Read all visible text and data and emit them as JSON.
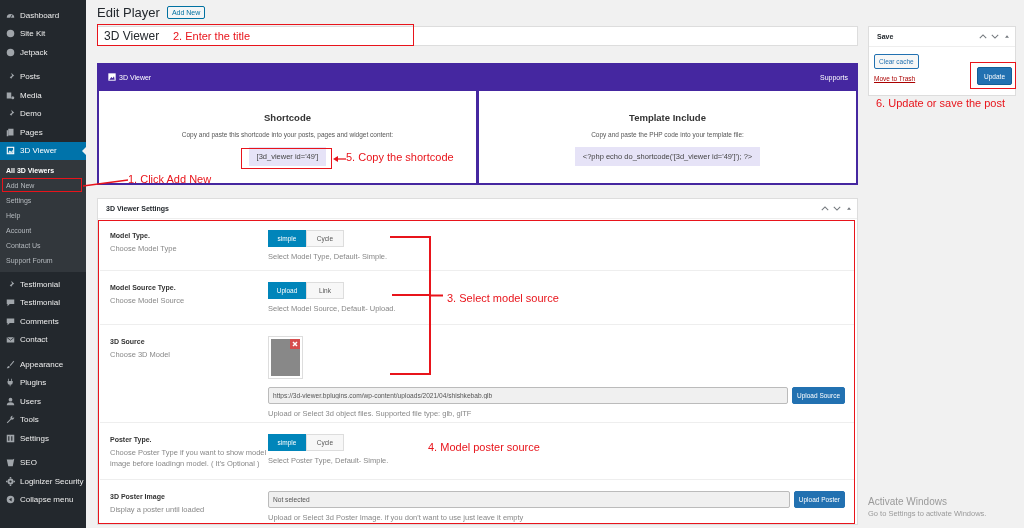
{
  "sidebar": {
    "groups": [
      [
        {
          "label": "Dashboard",
          "selected": false
        },
        {
          "label": "Site Kit",
          "selected": false
        },
        {
          "label": "Jetpack",
          "selected": false
        }
      ],
      [
        {
          "label": "Posts",
          "selected": false
        },
        {
          "label": "Media",
          "selected": false
        },
        {
          "label": "Demo",
          "selected": false
        },
        {
          "label": "Pages",
          "selected": false
        },
        {
          "label": "3D Viewer",
          "selected": true,
          "children": [
            {
              "label": "All 3D Viewers",
              "selected": true
            },
            {
              "label": "Add New",
              "selected": false
            },
            {
              "label": "Settings",
              "selected": false
            },
            {
              "label": "Help",
              "selected": false
            },
            {
              "label": "Account",
              "selected": false
            },
            {
              "label": "Contact Us",
              "selected": false
            },
            {
              "label": "Support Forum",
              "selected": false
            }
          ]
        }
      ],
      [
        {
          "label": "Testimonial",
          "selected": false
        },
        {
          "label": "Testimonial",
          "selected": false
        },
        {
          "label": "Comments",
          "selected": false
        },
        {
          "label": "Contact",
          "selected": false
        }
      ],
      [
        {
          "label": "Appearance",
          "selected": false
        },
        {
          "label": "Plugins",
          "selected": false
        },
        {
          "label": "Users",
          "selected": false
        },
        {
          "label": "Tools",
          "selected": false
        },
        {
          "label": "Settings",
          "selected": false
        }
      ],
      [
        {
          "label": "SEO",
          "selected": false
        },
        {
          "label": "Loginizer Security",
          "selected": false
        },
        {
          "label": "Collapse menu",
          "selected": false
        }
      ]
    ]
  },
  "header": {
    "title": "Edit Player",
    "button": "Add New"
  },
  "title_field": {
    "value": "3D Viewer"
  },
  "plugin_panel": {
    "name": "3D Viewer",
    "link": "Supports",
    "cards": [
      {
        "title": "Shortcode",
        "description": "Copy and paste this shortcode into your posts, pages and widget content:",
        "code": "[3d_viewer id='49']"
      },
      {
        "title": "Template Include",
        "description": "Copy and paste the PHP code into your template file:",
        "code": "<?php echo do_shortcode('[3d_viewer id='49']'); ?>"
      }
    ]
  },
  "settings": {
    "title": "3D Viewer Settings",
    "rows": [
      {
        "kind": "toggle",
        "label": "Model Type.",
        "description": "Choose Model Type",
        "options": [
          {
            "label": "simple",
            "selected": true
          },
          {
            "label": "Cycle",
            "selected": false
          }
        ],
        "help": "Select Model Type, Default- Simple."
      },
      {
        "kind": "toggle",
        "label": "Model Source Type.",
        "description": "Choose Model Source",
        "options": [
          {
            "label": "Upload",
            "selected": true
          },
          {
            "label": "Link",
            "selected": false
          }
        ],
        "help": "Select Model Source, Default- Upload."
      },
      {
        "kind": "media",
        "label": "3D Source",
        "description": "Choose 3D Model",
        "value": "https://3d-viewer.bplugins.com/wp-content/uploads/2021/04/shishkebab.glb",
        "button": "Upload Source",
        "help": "Upload or Select 3d object files. Supported file type: glb, glTF"
      },
      {
        "kind": "toggle",
        "label": "Poster Type.",
        "description": "Choose Poster Type if you want to show model image before loadingn model. ( It's Optional )",
        "options": [
          {
            "label": "simple",
            "selected": true
          },
          {
            "label": "Cycle",
            "selected": false
          }
        ],
        "help": "Select Poster Type, Default- Simple."
      },
      {
        "kind": "file",
        "label": "3D Poster Image",
        "description": "Display a poster until loaded",
        "value": "Not selected",
        "button": "Upload Poster",
        "help": "Upload or Select 3d Poster Image. if you don't want to use just leave it empty"
      }
    ]
  },
  "save_box": {
    "title": "Save",
    "clear_button": "Clear cache",
    "trash_link": "Move to Trash",
    "update_button": "Update"
  },
  "annotations": [
    {
      "text": "1. Click Add New"
    },
    {
      "text": "2. Enter the title"
    },
    {
      "text": "3. Select model source"
    },
    {
      "text": "4. Model poster source"
    },
    {
      "text": "5. Copy the shortcode"
    },
    {
      "text": "6. Update or save the post"
    }
  ],
  "os_notice": {
    "title": "Activate Windows",
    "subtitle": "Go to Settings to activate Windows."
  }
}
